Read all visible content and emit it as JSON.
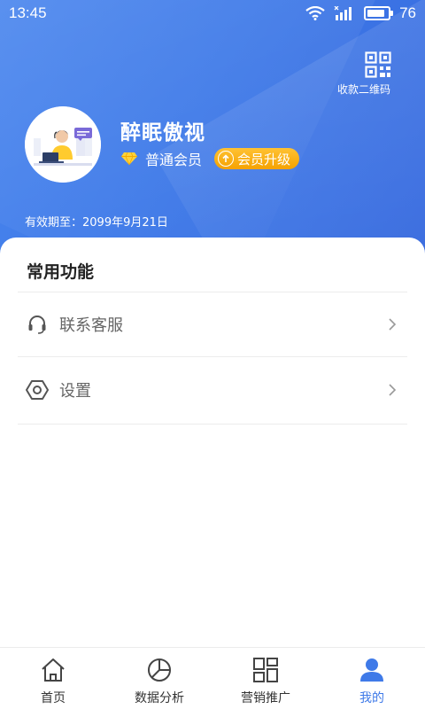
{
  "status_bar": {
    "time": "13:45",
    "battery": "76"
  },
  "header": {
    "qr_label": "收款二维码",
    "username": "醉眠傲视",
    "member_level": "普通会员",
    "upgrade_label": "会员升级",
    "expiry": "有效期至：2099年9月21日",
    "icons": {
      "qr": "qr-code-icon",
      "badge": "diamond-icon",
      "upgrade": "arrow-up-circle-icon"
    }
  },
  "functions": {
    "title": "常用功能",
    "items": [
      {
        "label": "联系客服",
        "icon": "headset-icon"
      },
      {
        "label": "设置",
        "icon": "settings-icon"
      }
    ]
  },
  "tabbar": {
    "tabs": [
      {
        "label": "首页",
        "icon": "home-icon",
        "active": false
      },
      {
        "label": "数据分析",
        "icon": "pie-chart-icon",
        "active": false
      },
      {
        "label": "营销推广",
        "icon": "layout-icon",
        "active": false
      },
      {
        "label": "我的",
        "icon": "user-icon",
        "active": true
      }
    ]
  },
  "colors": {
    "primary": "#3f7ae8",
    "accent": "#f5a200",
    "diamond": "#ffd23a"
  }
}
